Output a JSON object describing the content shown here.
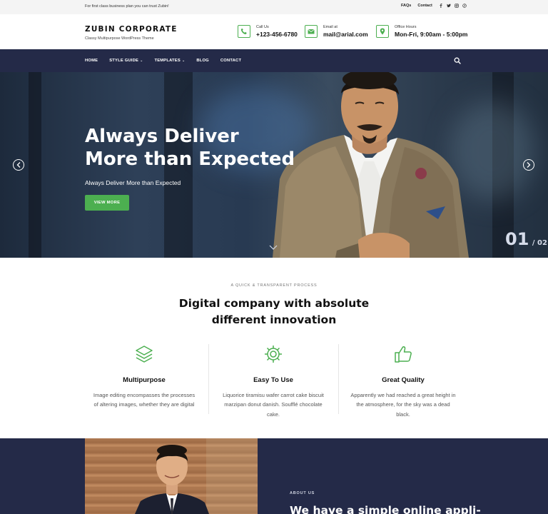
{
  "topbar": {
    "tagline": "For first class business plan you can trust Zubin!",
    "links": [
      "FAQs",
      "Contact"
    ],
    "social_icons": [
      "facebook-icon",
      "twitter-icon",
      "instagram-icon",
      "pinterest-icon"
    ]
  },
  "header": {
    "brand_name": "ZUBIN CORPORATE",
    "brand_sub": "Classy Multipurpose WordPress Theme",
    "call_label": "Call Us",
    "call_value": "+123-456-6780",
    "email_label": "Email at",
    "email_value": "mail@arial.com",
    "hours_label": "Office Hours",
    "hours_value": "Mon-Fri, 9:00am - 5:00pm"
  },
  "nav": {
    "items": [
      "HOME",
      "STYLE GUIDE",
      "TEMPLATES",
      "BLOG",
      "CONTACT"
    ]
  },
  "hero": {
    "title_line1": "Always Deliver",
    "title_line2": "More than Expected",
    "subtitle": "Always Deliver More than Expected",
    "button": "VIEW MORE",
    "slide_current": "01",
    "slide_total": "/ 02"
  },
  "process": {
    "kicker": "A QUICK & TRANSPARENT PROCESS",
    "title_line1": "Digital company with absolute",
    "title_line2": "different innovation",
    "features": [
      {
        "title": "Multipurpose",
        "desc": "Image editing encompasses the processes of altering images, whether they are digital",
        "icon": "layers-icon"
      },
      {
        "title": "Easy To Use",
        "desc": "Liquorice tiramisu wafer carrot cake biscuit marzipan donut danish. Soufflé chocolate cake.",
        "icon": "gear-icon"
      },
      {
        "title": "Great Quality",
        "desc": "Apparently we had reached a great height in the atmosphere, for the sky was a dead black.",
        "icon": "thumbs-up-icon"
      }
    ]
  },
  "about": {
    "kicker": "ABOUT US",
    "title": "We have a simple online appli-"
  },
  "colors": {
    "accent": "#4caf50",
    "navy": "#242a48"
  }
}
